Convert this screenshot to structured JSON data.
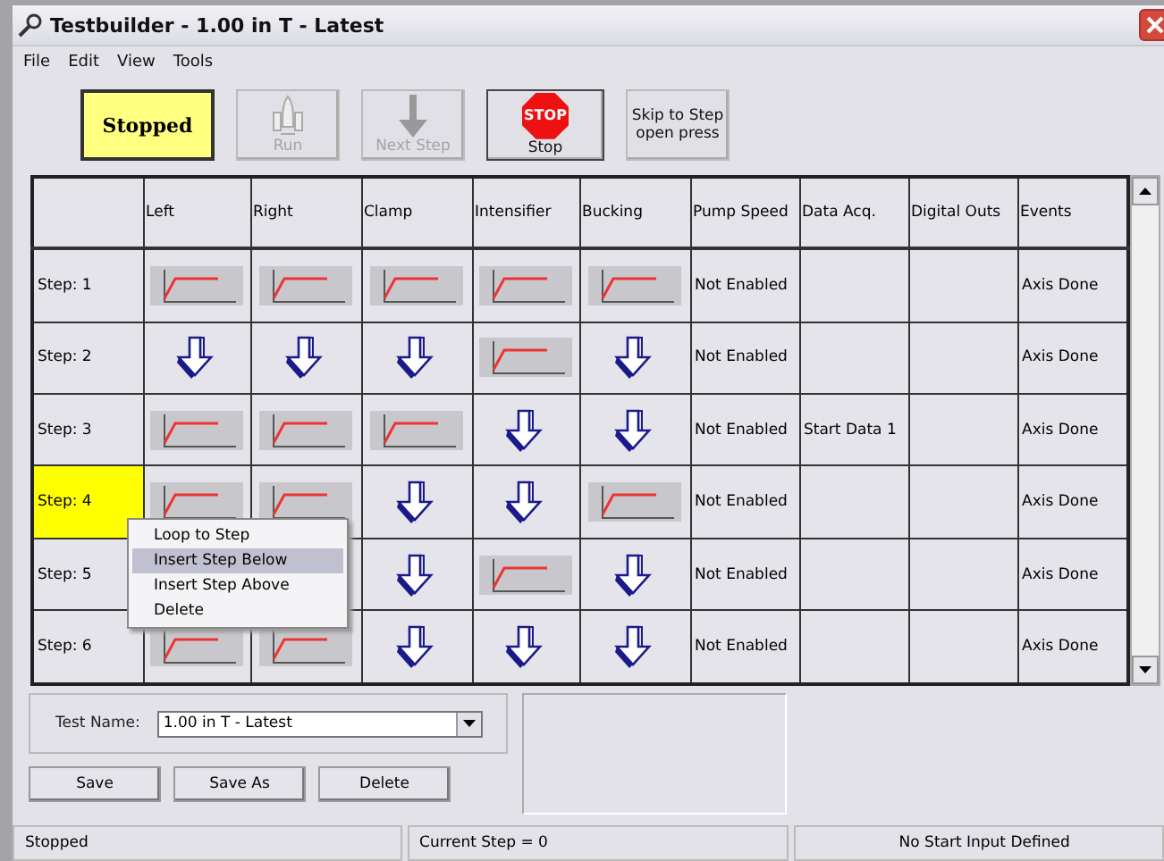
{
  "window": {
    "title": "Testbuilder - 1.00 in T - Latest"
  },
  "menu": [
    "File",
    "Edit",
    "View",
    "Tools"
  ],
  "toolbar": {
    "status": "Stopped",
    "buttons": [
      {
        "kind": "run",
        "label": "Run",
        "disabled": true
      },
      {
        "kind": "next",
        "label": "Next Step",
        "disabled": true
      },
      {
        "kind": "stop",
        "label": "Stop",
        "sign": "STOP",
        "disabled": false
      },
      {
        "kind": "text",
        "label": "Skip to Step",
        "sublabel": "open press",
        "disabled": false
      }
    ]
  },
  "grid": {
    "columns": [
      "Left",
      "Right",
      "Clamp",
      "Intensifier",
      "Bucking",
      "Pump Speed",
      "Data Acq.",
      "Digital Outs",
      "Events"
    ],
    "rows": [
      {
        "step": "Step:  1",
        "selected": false,
        "axes": [
          {
            "kind": "profile"
          },
          {
            "kind": "profile"
          },
          {
            "kind": "profile"
          },
          {
            "kind": "profile"
          },
          {
            "kind": "profile"
          }
        ],
        "pump_speed": "Not Enabled",
        "events": "Axis Done"
      },
      {
        "step": "Step:  2",
        "selected": false,
        "axes": [
          {
            "kind": "arrow"
          },
          {
            "kind": "arrow"
          },
          {
            "kind": "arrow"
          },
          {
            "kind": "profile"
          },
          {
            "kind": "arrow"
          }
        ],
        "pump_speed": "Not Enabled",
        "events": "Axis Done"
      },
      {
        "step": "Step:  3",
        "selected": false,
        "axes": [
          {
            "kind": "profile"
          },
          {
            "kind": "profile"
          },
          {
            "kind": "profile"
          },
          {
            "kind": "arrow"
          },
          {
            "kind": "arrow"
          }
        ],
        "pump_speed": "Not Enabled",
        "data_acq": "Start Data 1",
        "events": "Axis Done"
      },
      {
        "step": "Step:  4",
        "selected": true,
        "axes": [
          {
            "kind": "profile"
          },
          {
            "kind": "profile"
          },
          {
            "kind": "arrow"
          },
          {
            "kind": "arrow"
          },
          {
            "kind": "profile"
          }
        ],
        "pump_speed": "Not Enabled",
        "events": "Axis Done"
      },
      {
        "step": "Step:  5",
        "selected": false,
        "axes": [
          {
            "kind": "covered"
          },
          {
            "kind": "covered"
          },
          {
            "kind": "arrow"
          },
          {
            "kind": "profile"
          },
          {
            "kind": "arrow"
          }
        ],
        "pump_speed": "Not Enabled",
        "events": "Axis Done"
      },
      {
        "step": "Step:  6",
        "selected": false,
        "axes": [
          {
            "kind": "profile"
          },
          {
            "kind": "profile"
          },
          {
            "kind": "arrow"
          },
          {
            "kind": "arrow"
          },
          {
            "kind": "arrow"
          }
        ],
        "pump_speed": "Not Enabled",
        "events": "Axis Done"
      }
    ]
  },
  "context_menu": [
    {
      "label": "Loop to Step",
      "selected": false
    },
    {
      "label": "Insert Step Below",
      "selected": true
    },
    {
      "label": "Insert Step Above",
      "selected": false
    },
    {
      "label": "Delete",
      "selected": false
    }
  ],
  "test_name": {
    "label": "Test Name:",
    "value": "1.00 in T - Latest"
  },
  "actions": [
    "Save",
    "Save As",
    "Delete"
  ],
  "status_bar": [
    "Stopped",
    "Current Step = 0",
    "No Start Input Defined"
  ]
}
